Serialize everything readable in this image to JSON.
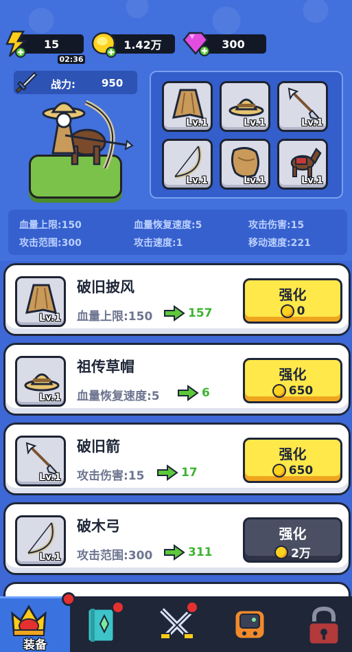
{
  "currencies": {
    "energy": {
      "value": "15",
      "timer": "02:36",
      "icon": "lightning-icon"
    },
    "gold": {
      "value": "1.42万",
      "icon": "gold-coin-icon"
    },
    "gems": {
      "value": "300",
      "icon": "gem-icon"
    }
  },
  "hero": {
    "power_label": "战力:",
    "power_value": "950"
  },
  "equipment_slots": [
    {
      "name": "cape",
      "level": "Lv.1"
    },
    {
      "name": "straw-hat",
      "level": "Lv.1"
    },
    {
      "name": "arrow",
      "level": "Lv.1"
    },
    {
      "name": "bow",
      "level": "Lv.1"
    },
    {
      "name": "armor",
      "level": "Lv.1"
    },
    {
      "name": "horse",
      "level": "Lv.1"
    }
  ],
  "stats": {
    "max_hp": "血量上限:150",
    "hp_regen": "血量恢复速度:5",
    "attack_damage": "攻击伤害:15",
    "attack_range": "攻击范围:300",
    "attack_speed": "攻击速度:1",
    "move_speed": "移动速度:221"
  },
  "items": [
    {
      "name": "破旧披风",
      "level": "Lv.1",
      "stat": "血量上限:150",
      "next": "157",
      "button": "强化",
      "cost": "0",
      "enabled": true
    },
    {
      "name": "祖传草帽",
      "level": "Lv.1",
      "stat": "血量恢复速度:5",
      "next": "6",
      "button": "强化",
      "cost": "650",
      "enabled": true
    },
    {
      "name": "破旧箭",
      "level": "Lv.1",
      "stat": "攻击伤害:15",
      "next": "17",
      "button": "强化",
      "cost": "650",
      "enabled": true
    },
    {
      "name": "破木弓",
      "level": "Lv.1",
      "stat": "攻击范围:300",
      "next": "311",
      "button": "强化",
      "cost": "2万",
      "enabled": false
    }
  ],
  "nav": {
    "equip_label": "装备",
    "tabs": [
      "crown-icon",
      "book-icon",
      "swords-icon",
      "device-icon",
      "lock-icon"
    ]
  },
  "colors": {
    "background": "#3d68d6",
    "button_yellow": "#ffe84a",
    "button_gray": "#4a4f63",
    "increase_green": "#3db431",
    "nav_bg": "#1e2638",
    "nav_active": "#3a73e0"
  }
}
